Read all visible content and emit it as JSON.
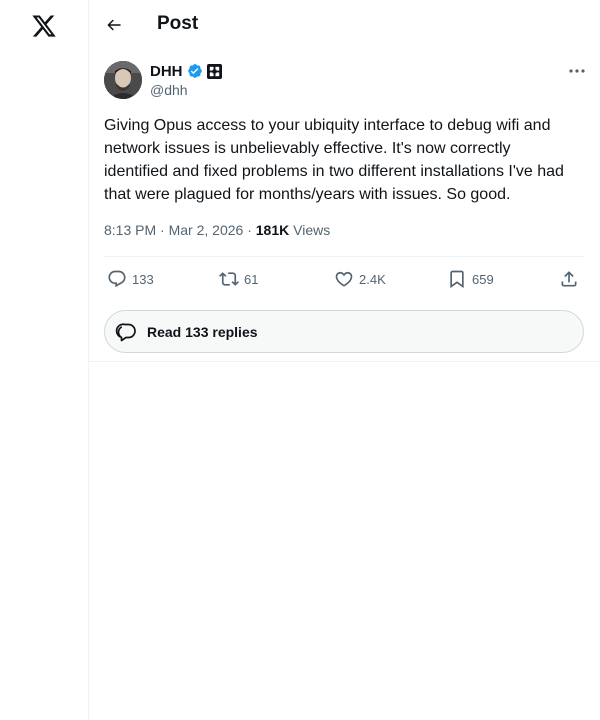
{
  "header": {
    "title": "Post"
  },
  "post": {
    "author": {
      "name": "DHH",
      "handle": "@dhh"
    },
    "text": "Giving Opus access to your ubiquity interface to debug wifi and network issues is unbelievably effective. It's now correctly identified and fixed problems in two different installations I've had that were plagued for months/years with issues. So good.",
    "time": "8:13 PM",
    "date": "Mar 2, 2026",
    "views_count": "181K",
    "views_label": "Views",
    "meta_sep": " · "
  },
  "actions": {
    "replies": "133",
    "reposts": "61",
    "likes": "2.4K",
    "bookmarks": "659"
  },
  "read_replies": {
    "label": "Read 133 replies"
  },
  "icons": {
    "logo": "x-logo-icon",
    "back": "arrow-left-icon",
    "verified": "verified-badge-icon",
    "affiliate": "affiliate-badge-icon",
    "more": "more-dots-icon",
    "reply": "reply-icon",
    "repost": "repost-icon",
    "like": "heart-icon",
    "bookmark": "bookmark-icon",
    "share": "share-icon",
    "read_replies": "chat-bubbles-icon"
  },
  "colors": {
    "accent": "#1d9bf0",
    "text": "#0f1419",
    "muted": "#536471",
    "border": "#eff3f4"
  }
}
